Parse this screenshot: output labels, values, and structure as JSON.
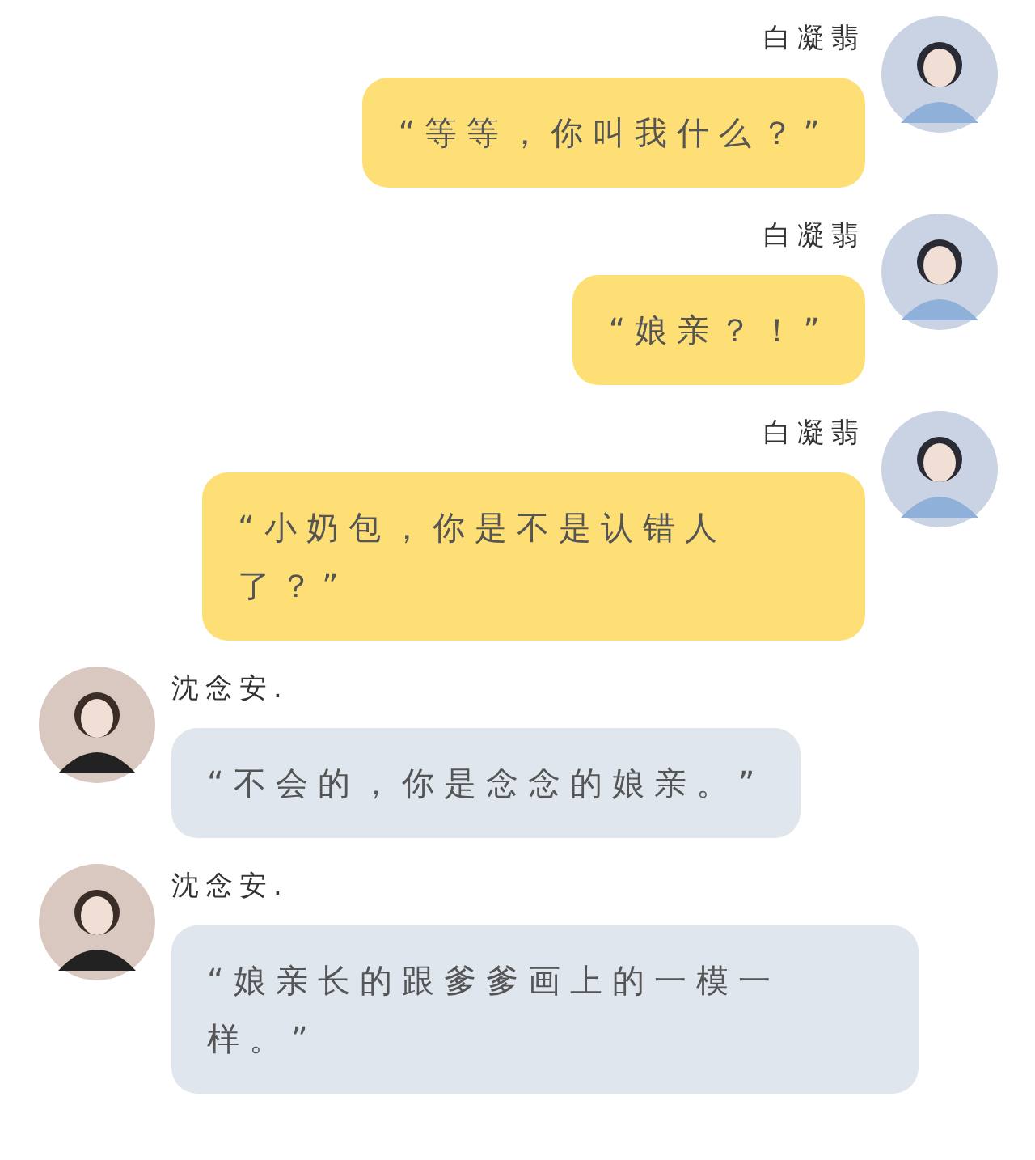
{
  "messages": [
    {
      "kind": "outgoing",
      "sender": "白凝翡",
      "text": "“等等，你叫我什么？”"
    },
    {
      "kind": "outgoing",
      "sender": "白凝翡",
      "text": "“娘亲？！”"
    },
    {
      "kind": "outgoing",
      "sender": "白凝翡",
      "text": "“小奶包，你是不是认错人了？”"
    },
    {
      "kind": "incoming",
      "sender": "沈念安.",
      "text": "“不会的，你是念念的娘亲。”"
    },
    {
      "kind": "incoming",
      "sender": "沈念安.",
      "text": "“娘亲长的跟爹爹画上的一模一样。”"
    }
  ]
}
